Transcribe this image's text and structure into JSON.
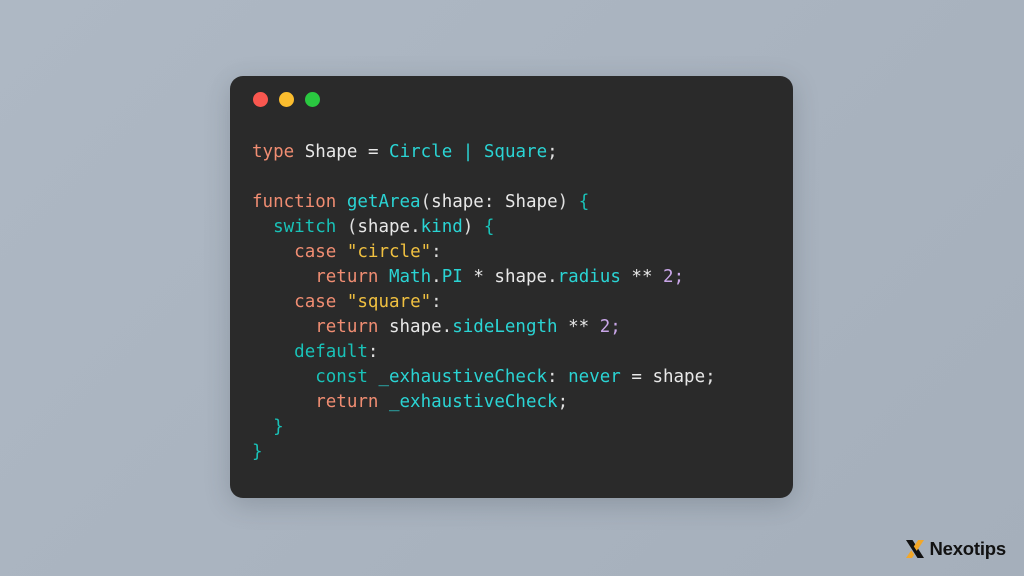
{
  "background": {
    "color_top_left": "#aeb8c4",
    "color_bottom_right": "#a5afbb"
  },
  "code_window": {
    "background_color": "#2a2a2a",
    "traffic_lights": [
      {
        "name": "close",
        "color": "#f9574f"
      },
      {
        "name": "minimize",
        "color": "#fbbd2e"
      },
      {
        "name": "maximize",
        "color": "#2ac840"
      }
    ],
    "language": "TypeScript",
    "theme_colors": {
      "keyword": "#f08d72",
      "keyword_control": "#19c2b8",
      "type": "#2ad4d4",
      "string": "#f0c040",
      "number": "#c9a6e8",
      "plain": "#e8e8e8",
      "brace": "#19c2b8"
    },
    "lines": [
      {
        "n": 1,
        "tokens": [
          {
            "t": "type",
            "c": "kw"
          },
          {
            "t": " ",
            "c": "punc"
          },
          {
            "t": "Shape",
            "c": "ident"
          },
          {
            "t": " ",
            "c": "punc"
          },
          {
            "t": "=",
            "c": "op"
          },
          {
            "t": " ",
            "c": "punc"
          },
          {
            "t": "Circle",
            "c": "type"
          },
          {
            "t": " ",
            "c": "punc"
          },
          {
            "t": "|",
            "c": "type"
          },
          {
            "t": " ",
            "c": "punc"
          },
          {
            "t": "Square",
            "c": "type"
          },
          {
            "t": ";",
            "c": "punc"
          }
        ]
      },
      {
        "n": 2,
        "tokens": []
      },
      {
        "n": 3,
        "tokens": [
          {
            "t": "function",
            "c": "kw"
          },
          {
            "t": " ",
            "c": "punc"
          },
          {
            "t": "getArea",
            "c": "type"
          },
          {
            "t": "(",
            "c": "punc"
          },
          {
            "t": "shape",
            "c": "ident"
          },
          {
            "t": ":",
            "c": "punc"
          },
          {
            "t": " ",
            "c": "punc"
          },
          {
            "t": "Shape",
            "c": "ident"
          },
          {
            "t": ")",
            "c": "punc"
          },
          {
            "t": " ",
            "c": "punc"
          },
          {
            "t": "{",
            "c": "brace"
          }
        ]
      },
      {
        "n": 4,
        "tokens": [
          {
            "t": "  ",
            "c": "punc"
          },
          {
            "t": "switch",
            "c": "kw2"
          },
          {
            "t": " ",
            "c": "punc"
          },
          {
            "t": "(",
            "c": "punc"
          },
          {
            "t": "shape",
            "c": "ident"
          },
          {
            "t": ".",
            "c": "punc"
          },
          {
            "t": "kind",
            "c": "type"
          },
          {
            "t": ")",
            "c": "punc"
          },
          {
            "t": " ",
            "c": "punc"
          },
          {
            "t": "{",
            "c": "brace"
          }
        ]
      },
      {
        "n": 5,
        "tokens": [
          {
            "t": "    ",
            "c": "punc"
          },
          {
            "t": "case",
            "c": "kw"
          },
          {
            "t": " ",
            "c": "punc"
          },
          {
            "t": "\"circle\"",
            "c": "str"
          },
          {
            "t": ":",
            "c": "punc"
          }
        ]
      },
      {
        "n": 6,
        "tokens": [
          {
            "t": "      ",
            "c": "punc"
          },
          {
            "t": "return",
            "c": "kw"
          },
          {
            "t": " ",
            "c": "punc"
          },
          {
            "t": "Math",
            "c": "type"
          },
          {
            "t": ".",
            "c": "punc"
          },
          {
            "t": "PI",
            "c": "type"
          },
          {
            "t": " ",
            "c": "punc"
          },
          {
            "t": "*",
            "c": "op"
          },
          {
            "t": " ",
            "c": "punc"
          },
          {
            "t": "shape",
            "c": "ident"
          },
          {
            "t": ".",
            "c": "punc"
          },
          {
            "t": "radius",
            "c": "type"
          },
          {
            "t": " ",
            "c": "punc"
          },
          {
            "t": "**",
            "c": "op"
          },
          {
            "t": " ",
            "c": "punc"
          },
          {
            "t": "2",
            "c": "num"
          },
          {
            "t": ";",
            "c": "num"
          }
        ]
      },
      {
        "n": 7,
        "tokens": [
          {
            "t": "    ",
            "c": "punc"
          },
          {
            "t": "case",
            "c": "kw"
          },
          {
            "t": " ",
            "c": "punc"
          },
          {
            "t": "\"square\"",
            "c": "str"
          },
          {
            "t": ":",
            "c": "punc"
          }
        ]
      },
      {
        "n": 8,
        "tokens": [
          {
            "t": "      ",
            "c": "punc"
          },
          {
            "t": "return",
            "c": "kw"
          },
          {
            "t": " ",
            "c": "punc"
          },
          {
            "t": "shape",
            "c": "ident"
          },
          {
            "t": ".",
            "c": "punc"
          },
          {
            "t": "sideLength",
            "c": "type"
          },
          {
            "t": " ",
            "c": "punc"
          },
          {
            "t": "**",
            "c": "op"
          },
          {
            "t": " ",
            "c": "punc"
          },
          {
            "t": "2",
            "c": "num"
          },
          {
            "t": ";",
            "c": "num"
          }
        ]
      },
      {
        "n": 9,
        "tokens": [
          {
            "t": "    ",
            "c": "punc"
          },
          {
            "t": "default",
            "c": "kw2"
          },
          {
            "t": ":",
            "c": "punc"
          }
        ]
      },
      {
        "n": 10,
        "tokens": [
          {
            "t": "      ",
            "c": "punc"
          },
          {
            "t": "const",
            "c": "kw2"
          },
          {
            "t": " ",
            "c": "punc"
          },
          {
            "t": "_exhaustiveCheck",
            "c": "type"
          },
          {
            "t": ":",
            "c": "punc"
          },
          {
            "t": " ",
            "c": "punc"
          },
          {
            "t": "never",
            "c": "type"
          },
          {
            "t": " ",
            "c": "punc"
          },
          {
            "t": "=",
            "c": "op"
          },
          {
            "t": " ",
            "c": "punc"
          },
          {
            "t": "shape",
            "c": "ident"
          },
          {
            "t": ";",
            "c": "punc"
          }
        ]
      },
      {
        "n": 11,
        "tokens": [
          {
            "t": "      ",
            "c": "punc"
          },
          {
            "t": "return",
            "c": "kw"
          },
          {
            "t": " ",
            "c": "punc"
          },
          {
            "t": "_exhaustiveCheck",
            "c": "type"
          },
          {
            "t": ";",
            "c": "punc"
          }
        ]
      },
      {
        "n": 12,
        "tokens": [
          {
            "t": "  ",
            "c": "punc"
          },
          {
            "t": "}",
            "c": "brace"
          }
        ]
      },
      {
        "n": 13,
        "tokens": [
          {
            "t": "}",
            "c": "brace"
          }
        ]
      }
    ],
    "plain_text": "type Shape = Circle | Square;\n\nfunction getArea(shape: Shape) {\n  switch (shape.kind) {\n    case \"circle\":\n      return Math.PI * shape.radius ** 2;\n    case \"square\":\n      return shape.sideLength ** 2;\n    default:\n      const _exhaustiveCheck: never = shape;\n      return _exhaustiveCheck;\n  }\n}"
  },
  "watermark": {
    "icon": "nexotips-x-logo-icon",
    "text": "Nexotips",
    "mark_color_dark": "#121212",
    "mark_color_accent": "#f2a729",
    "text_color": "#121212"
  }
}
